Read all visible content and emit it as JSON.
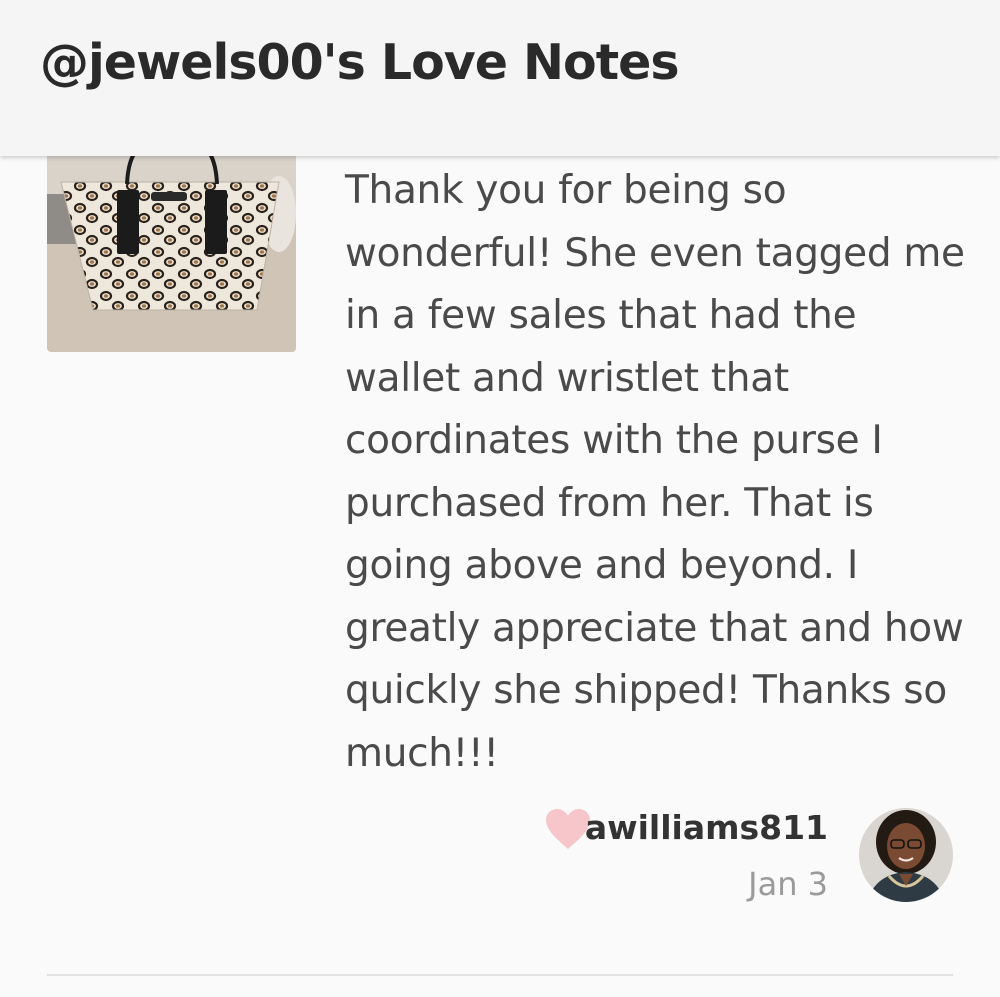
{
  "header": {
    "title": "@jewels00's Love Notes"
  },
  "note": {
    "text": "Thank you for being so wonderful! She even tagged me in a few sales that had the wallet and wristlet that coordinates with the purse I purchased from her. That is going above and beyond. I greatly appreciate that and how quickly she shipped! Thanks so much!!!",
    "author": "awilliams811",
    "date": "Jan 3"
  },
  "icons": {
    "like": "heart-icon"
  },
  "colors": {
    "heart": "#f6c6cb",
    "header_bg": "#f5f5f5",
    "page_bg": "#fafafa"
  }
}
